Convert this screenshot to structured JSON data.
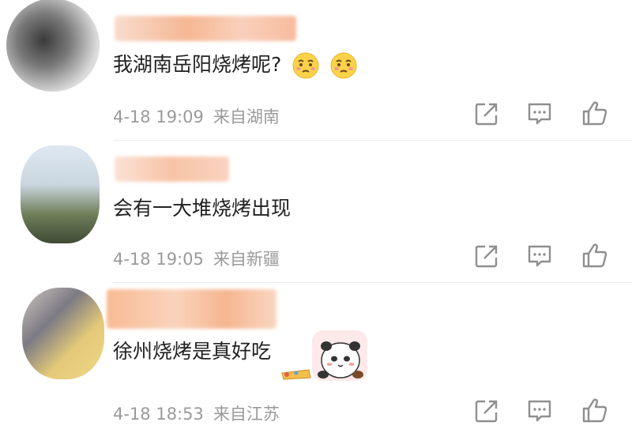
{
  "comments": [
    {
      "text": "我湖南岳阳烧烤呢?",
      "emojis": [
        "sad-face-emoji",
        "sad-face-emoji"
      ],
      "time": "4-18 19:09",
      "location": "来自湖南"
    },
    {
      "text": "会有一大堆烧烤出现",
      "time": "4-18 19:05",
      "location": "来自新疆"
    },
    {
      "text": "徐州烧烤是真好吃",
      "sticker": "panda-sticker",
      "time": "4-18 18:53",
      "location": "来自江苏"
    }
  ],
  "icons": {
    "share": "share-icon",
    "comment": "comment-icon",
    "like": "thumbs-up-icon"
  },
  "colors": {
    "text": "#222222",
    "meta": "#9a9a9a",
    "icon": "#8f8f8f",
    "name_blur": "#f4a072"
  }
}
